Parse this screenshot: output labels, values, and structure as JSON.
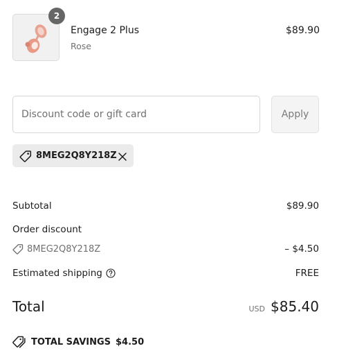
{
  "line_item": {
    "quantity": "2",
    "name": "Engage 2 Plus",
    "variant": "Rose",
    "price": "$89.90",
    "image_icon": "earbuds-product-image"
  },
  "discount": {
    "placeholder": "Discount code or gift card",
    "value": "",
    "apply_label": "Apply",
    "applied_code": "8MEG2Q8Y218Z"
  },
  "summary": {
    "subtotal_label": "Subtotal",
    "subtotal_value": "$89.90",
    "order_discount_label": "Order discount",
    "order_discount_code": "8MEG2Q8Y218Z",
    "order_discount_value": "– $4.50",
    "shipping_label": "Estimated shipping",
    "shipping_value": "FREE",
    "total_label": "Total",
    "currency": "USD",
    "total_value": "$85.40",
    "savings_label": "TOTAL SAVINGS",
    "savings_value": "$4.50"
  },
  "colors": {
    "text": "#1c1c1c",
    "muted": "#707070",
    "chip_bg": "#ebebeb",
    "badge_bg": "#666666",
    "product": "#e89a86"
  }
}
